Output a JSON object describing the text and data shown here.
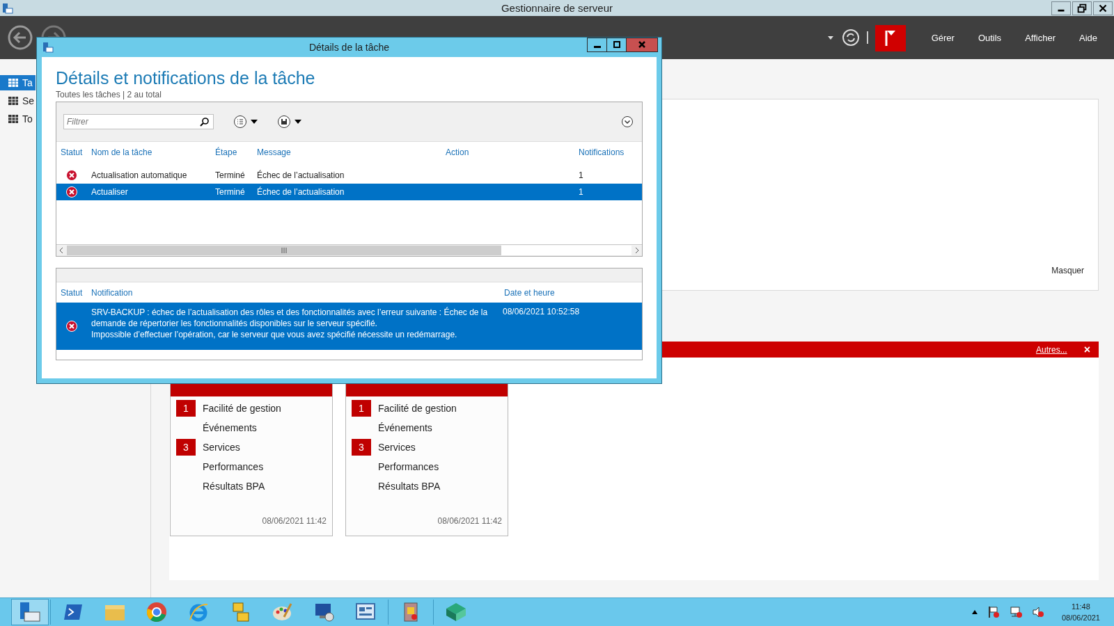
{
  "window": {
    "title": "Gestionnaire de serveur"
  },
  "menu": [
    {
      "label": "Gérer"
    },
    {
      "label": "Outils"
    },
    {
      "label": "Afficher"
    },
    {
      "label": "Aide"
    }
  ],
  "sidebar": {
    "items": [
      {
        "label": "Ta",
        "selected": true
      },
      {
        "label": "Se",
        "selected": false
      },
      {
        "label": "To",
        "selected": false
      }
    ]
  },
  "welcome_panel": {
    "hide_link": "Masquer"
  },
  "alert_bar": {
    "link": "Autres...",
    "close": "×"
  },
  "tiles": [
    {
      "items": [
        {
          "label": "Facilité de gestion",
          "count": "1"
        },
        {
          "label": "Événements"
        },
        {
          "label": "Services",
          "count": "3"
        },
        {
          "label": "Performances"
        },
        {
          "label": "Résultats BPA"
        }
      ],
      "timestamp": "08/06/2021 11:42"
    },
    {
      "items": [
        {
          "label": "Facilité de gestion",
          "count": "1"
        },
        {
          "label": "Événements"
        },
        {
          "label": "Services",
          "count": "3"
        },
        {
          "label": "Performances"
        },
        {
          "label": "Résultats BPA"
        }
      ],
      "timestamp": "08/06/2021 11:42"
    }
  ],
  "dialog": {
    "title": "Détails de la tâche",
    "heading": "Détails et notifications de la tâche",
    "subtitle": "Toutes les tâches | 2 au total",
    "filter": {
      "placeholder": "Filtrer"
    },
    "tasks": {
      "columns": [
        "Statut",
        "Nom de la tâche",
        "Étape",
        "Message",
        "Action",
        "Notifications"
      ],
      "rows": [
        {
          "error": true,
          "name": "Actualisation automatique",
          "stage": "Terminé",
          "message": "Échec de l’actualisation",
          "notifications": "1",
          "selected": false
        },
        {
          "error": true,
          "name": "Actualiser",
          "stage": "Terminé",
          "message": "Échec de l’actualisation",
          "notifications": "1",
          "selected": true
        }
      ]
    },
    "notifications": {
      "columns": [
        "Statut",
        "Notification",
        "Date et heure"
      ],
      "rows": [
        {
          "error": true,
          "paragraphs": [
            "SRV-BACKUP : échec de l’actualisation des rôles et des fonctionnalités avec l’erreur suivante : Échec de la demande de répertorier les fonctionnalités disponibles sur le serveur spécifié.",
            "Impossible d’effectuer l’opération, car le serveur que vous avez spécifié nécessite un redémarrage."
          ],
          "date": "08/06/2021 10:52:58",
          "selected": true
        }
      ]
    }
  },
  "taskbar": {
    "time": "11:48",
    "date": "08/06/2021"
  }
}
